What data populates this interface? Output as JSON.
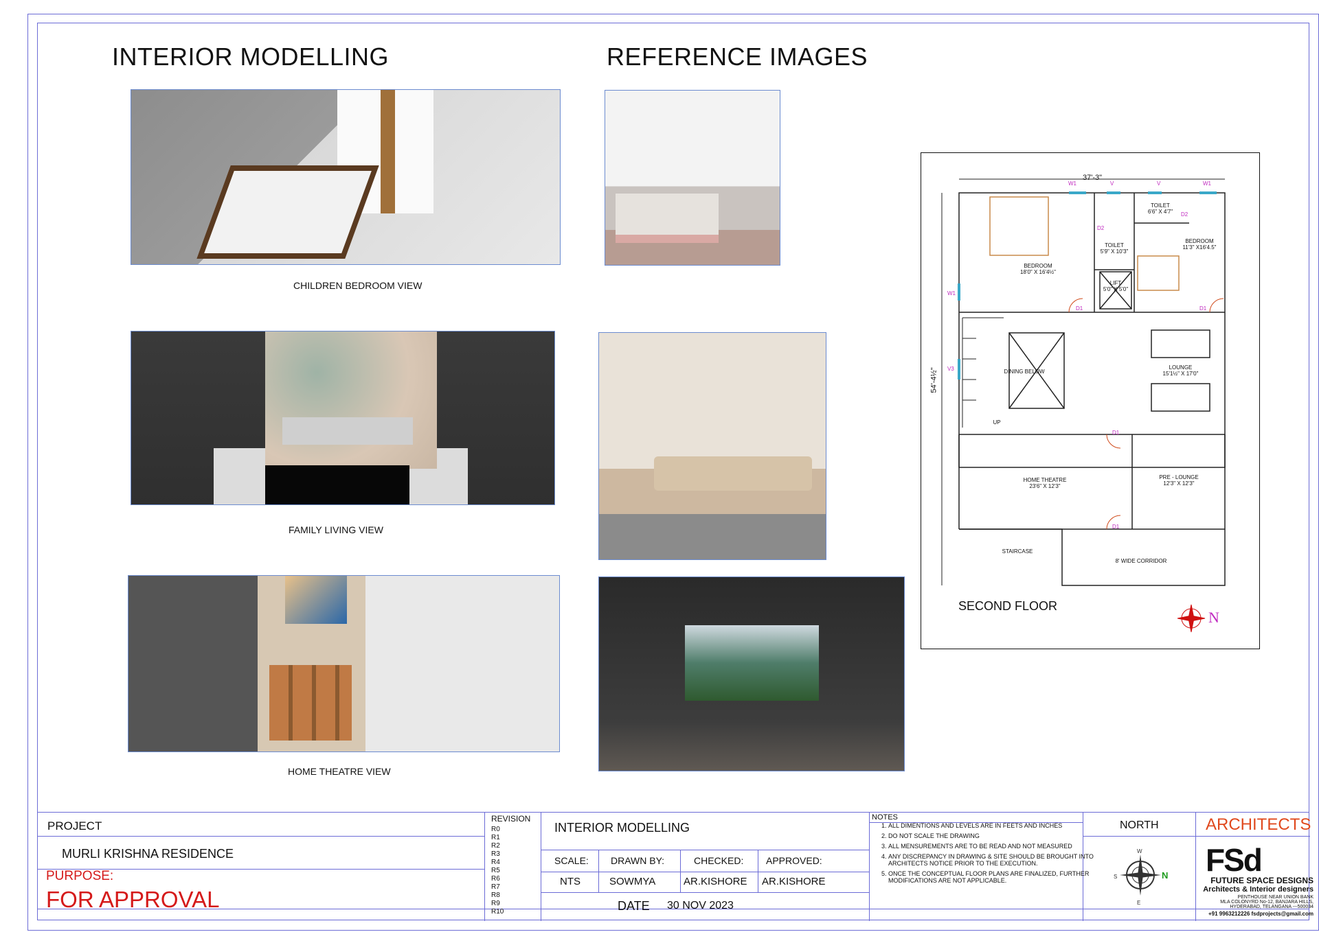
{
  "sheet": {
    "interior_heading": "INTERIOR MODELLING",
    "reference_heading": "REFERENCE IMAGES",
    "captions": {
      "children_bedroom": "CHILDREN BEDROOM VIEW",
      "family_living": "FAMILY LIVING  VIEW",
      "home_theatre": "HOME THEATRE  VIEW"
    }
  },
  "plan": {
    "title": "SECOND FLOOR",
    "width_dim": "37'-3\"",
    "height_dim": "54'-4½\"",
    "north": "N",
    "rooms": {
      "bedroom1": "BEDROOM",
      "bedroom1_size": "18'0\" X 16'4½\"",
      "toilet1": "TOILET",
      "toilet1_size": "5'9\" X 10'3\"",
      "toilet2": "TOILET",
      "toilet2_size": "6'6\" X 4'7\"",
      "bedroom2": "BEDROOM",
      "bedroom2_size": "11'3\" X16'4.5\"",
      "lift": "LIFT",
      "lift_size": "5'0\" X 5'0\"",
      "dining": "DINING BELOW",
      "lounge": "LOUNGE",
      "lounge_size": "15'1½\" X 17'0\"",
      "home_theatre": "HOME THEATRE",
      "home_theatre_size": "23'6\" X 12'3\"",
      "pre_lounge": "PRE - LOUNGE",
      "pre_lounge_size": "12'3\" X 12'3\"",
      "staircase": "STAIRCASE",
      "corridor": "8' WIDE CORRIDOR",
      "up": "UP"
    },
    "tags": [
      "W1",
      "V",
      "V",
      "W1",
      "W1",
      "V3",
      "D1",
      "D1",
      "D1",
      "D1",
      "D2",
      "D2"
    ]
  },
  "title_block": {
    "project_label": "PROJECT",
    "project_name": "MURLI KRISHNA RESIDENCE",
    "purpose_label": "PURPOSE:",
    "purpose_value": "FOR APPROVAL",
    "revision_label": "REVISION",
    "revisions": [
      "R0",
      "R1",
      "R2",
      "R3",
      "R4",
      "R5",
      "R6",
      "R7",
      "R8",
      "R9",
      "R10"
    ],
    "drawing_title": "INTERIOR MODELLING",
    "scale_label": "SCALE:",
    "scale_value": "NTS",
    "drawn_label": "DRAWN BY:",
    "drawn_value": "SOWMYA",
    "checked_label": "CHECKED:",
    "checked_value": "AR.KISHORE",
    "approved_label": "APPROVED:",
    "approved_value": "AR.KISHORE",
    "date_label": "DATE",
    "date_value": "30 NOV 2023",
    "notes_label": "NOTES",
    "notes": [
      "ALL DIMENTIONS AND LEVELS ARE IN FEETS AND INCHES",
      "DO NOT SCALE THE DRAWING",
      "ALL MENSUREMENTS ARE TO BE  READ AND NOT MEASURED",
      "ANY DISCREPANCY IN DRAWING & SITE SHOULD BE BROUGHT INTO ARCHITECTS NOTICE PRIOR TO THE EXECUTION.",
      "ONCE THE CONCEPTUAL FLOOR PLANS ARE FINALIZED, FURTHER MODIFICATIONS ARE NOT APPLICABLE."
    ],
    "north_label": "NORTH",
    "architects_label": "ARCHITECTS",
    "logo_text": "FSd",
    "firm_name": "FUTURE SPACE DESIGNS",
    "firm_tagline": "Architects  &  Interior designers",
    "address_1": "PENTHOUSE    NEAR  UNION  BANK",
    "address_2": "MLA COLONYRD No-12,  BANJARA  HILLS,",
    "address_3": "HYDERABAD, TELANGANA ---500034",
    "contact": "+91 9963212226   fsdprojects@gmail.com"
  }
}
